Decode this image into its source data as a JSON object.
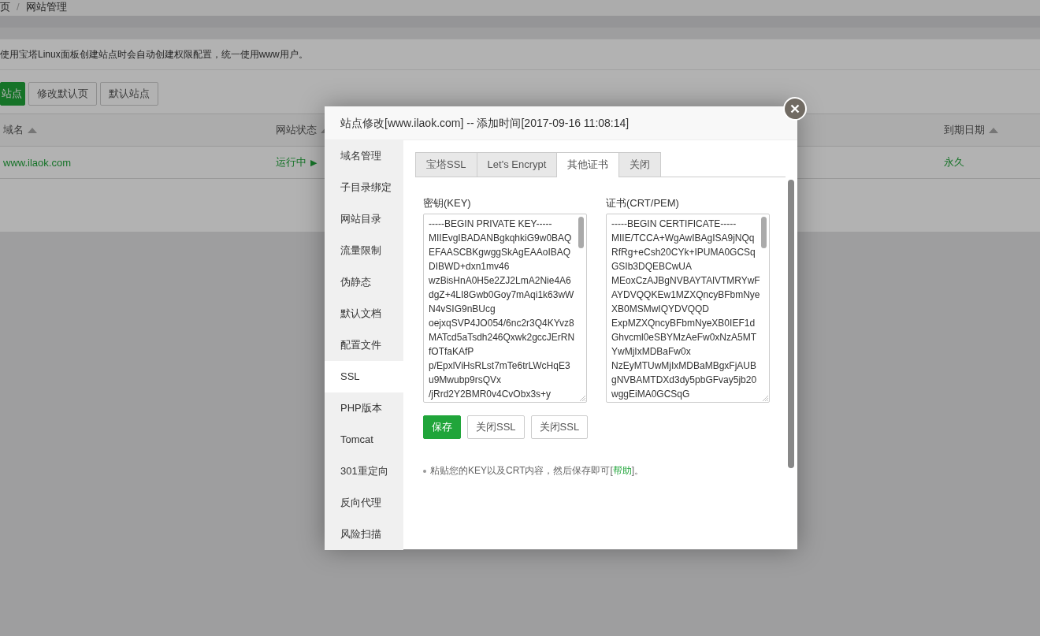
{
  "breadcrumb": {
    "home": "页",
    "separator": "/",
    "current": "网站管理"
  },
  "notice": "使用宝塔Linux面板创建站点时会自动创建权限配置，统一使用www用户。",
  "toolbar": [
    {
      "label": "站点",
      "kind": "primary"
    },
    {
      "label": "修改默认页",
      "kind": "default"
    },
    {
      "label": "默认站点",
      "kind": "default"
    }
  ],
  "table": {
    "columns": [
      {
        "label": "域名"
      },
      {
        "label": "网站状态"
      },
      {
        "label": "到期日期"
      }
    ],
    "rows": [
      {
        "domain": "www.ilaok.com",
        "status": "运行中",
        "status_icon": "▶",
        "expiry": "永久"
      }
    ]
  },
  "modal": {
    "title": "站点修改[www.ilaok.com] -- 添加时间[2017-09-16 11:08:14]",
    "sidebar": [
      {
        "label": "域名管理",
        "selected": false
      },
      {
        "label": "子目录绑定",
        "selected": false
      },
      {
        "label": "网站目录",
        "selected": false
      },
      {
        "label": "流量限制",
        "selected": false
      },
      {
        "label": "伪静态",
        "selected": false
      },
      {
        "label": "默认文档",
        "selected": false
      },
      {
        "label": "配置文件",
        "selected": false
      },
      {
        "label": "SSL",
        "selected": true
      },
      {
        "label": "PHP版本",
        "selected": false
      },
      {
        "label": "Tomcat",
        "selected": false
      },
      {
        "label": "301重定向",
        "selected": false
      },
      {
        "label": "反向代理",
        "selected": false
      },
      {
        "label": "风险扫描",
        "selected": false
      }
    ],
    "tabs": [
      {
        "label": "宝塔SSL",
        "selected": false
      },
      {
        "label": "Let's Encrypt",
        "selected": false
      },
      {
        "label": "其他证书",
        "selected": true
      },
      {
        "label": "关闭",
        "selected": false
      }
    ],
    "key": {
      "label": "密钥(KEY)",
      "lines": [
        "-----BEGIN PRIVATE KEY-----",
        "MIIEvgIBADANBgkqhkiG9w0BAQ",
        "EFAASCBKgwggSkAgEAAoIBAQ",
        "DIBWD+dxn1mv46",
        "wzBisHnA0H5e2ZJ2LmA2Nie4A6",
        "dgZ+4LI8Gwb0Goy7mAqi1k63wW",
        "N4vSIG9nBUcg",
        "oejxqSVP4JO054/6nc2r3Q4KYvz8",
        "MATcd5aTsdh246Qxwk2gccJErRN",
        "fOTfaKAfP",
        "p/EpxlViHsRLst7mTe6trLWcHqE3",
        "u9Mwubp9rsQVx",
        "/jRrd2Y2BMR0v4CvObx3s+y"
      ]
    },
    "cert": {
      "label": "证书(CRT/PEM)",
      "lines": [
        "-----BEGIN CERTIFICATE-----",
        "MIIE/TCCA+WgAwIBAgISA9jNQq",
        "RfRg+eCsh20CYk+IPUMA0GCSq",
        "GSIb3DQEBCwUA",
        "MEoxCzAJBgNVBAYTAlVTMRYwF",
        "AYDVQQKEw1MZXQncyBFbmNye",
        "XB0MSMwIQYDVQQD",
        "ExpMZXQncyBFbmNyeXB0IEF1d",
        "Ghvcml0eSBYMzAeFw0xNzA5MT",
        "YwMjIxMDBaFw0x",
        "NzEyMTUwMjIxMDBaMBgxFjAUB",
        "gNVBAMTDXd3dy5pbGFvay5jb20",
        "wggEiMA0GCSqG"
      ]
    },
    "buttons": [
      {
        "label": "保存",
        "kind": "primary"
      },
      {
        "label": "关闭SSL",
        "kind": "default"
      },
      {
        "label": "关闭SSL",
        "kind": "default"
      }
    ],
    "tip": {
      "text": "粘贴您的KEY以及CRT内容，然后保存即可[",
      "link": "帮助",
      "end": "]。"
    }
  }
}
